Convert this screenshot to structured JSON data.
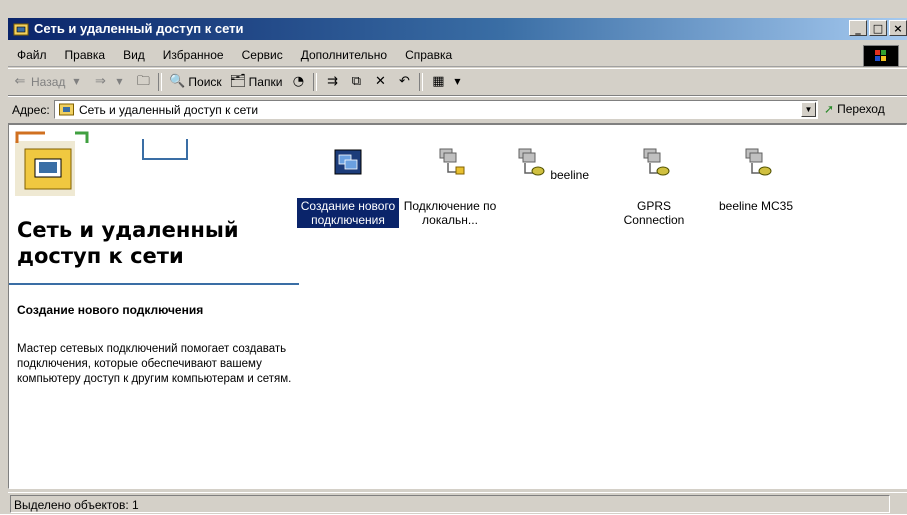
{
  "window": {
    "title": "Сеть и удаленный доступ к сети"
  },
  "menu": [
    "Файл",
    "Правка",
    "Вид",
    "Избранное",
    "Сервис",
    "Дополнительно",
    "Справка"
  ],
  "toolbar": {
    "back": "Назад",
    "search": "Поиск",
    "folders": "Папки"
  },
  "address": {
    "label": "Адрес:",
    "value": "Сеть и удаленный доступ к сети",
    "go": "Переход"
  },
  "left_pane": {
    "title": "Сеть и удаленный доступ к сети",
    "task_title": "Создание нового подключения",
    "task_desc": "Мастер сетевых подключений помогает создавать подключения, которые обеспечивают вашему компьютеру доступ к другим компьютерам и сетям."
  },
  "items": [
    {
      "label": "Создание нового подключения",
      "icon": "new-connection-icon",
      "selected": true
    },
    {
      "label": "Подключение по локальн...",
      "icon": "lan-connection-icon",
      "selected": false
    },
    {
      "label": "beeline",
      "icon": "dialup-connection-icon",
      "selected": false
    },
    {
      "label": "GPRS Connection",
      "icon": "dialup-connection-icon",
      "selected": false
    },
    {
      "label": "beeline MC35",
      "icon": "dialup-connection-icon",
      "selected": false
    }
  ],
  "status": {
    "text": "Выделено объектов: 1"
  },
  "colors": {
    "title_active": "#0a246a",
    "title_gradient_end": "#a6caf0",
    "selection": "#0a246a",
    "face": "#d4d0c8"
  }
}
